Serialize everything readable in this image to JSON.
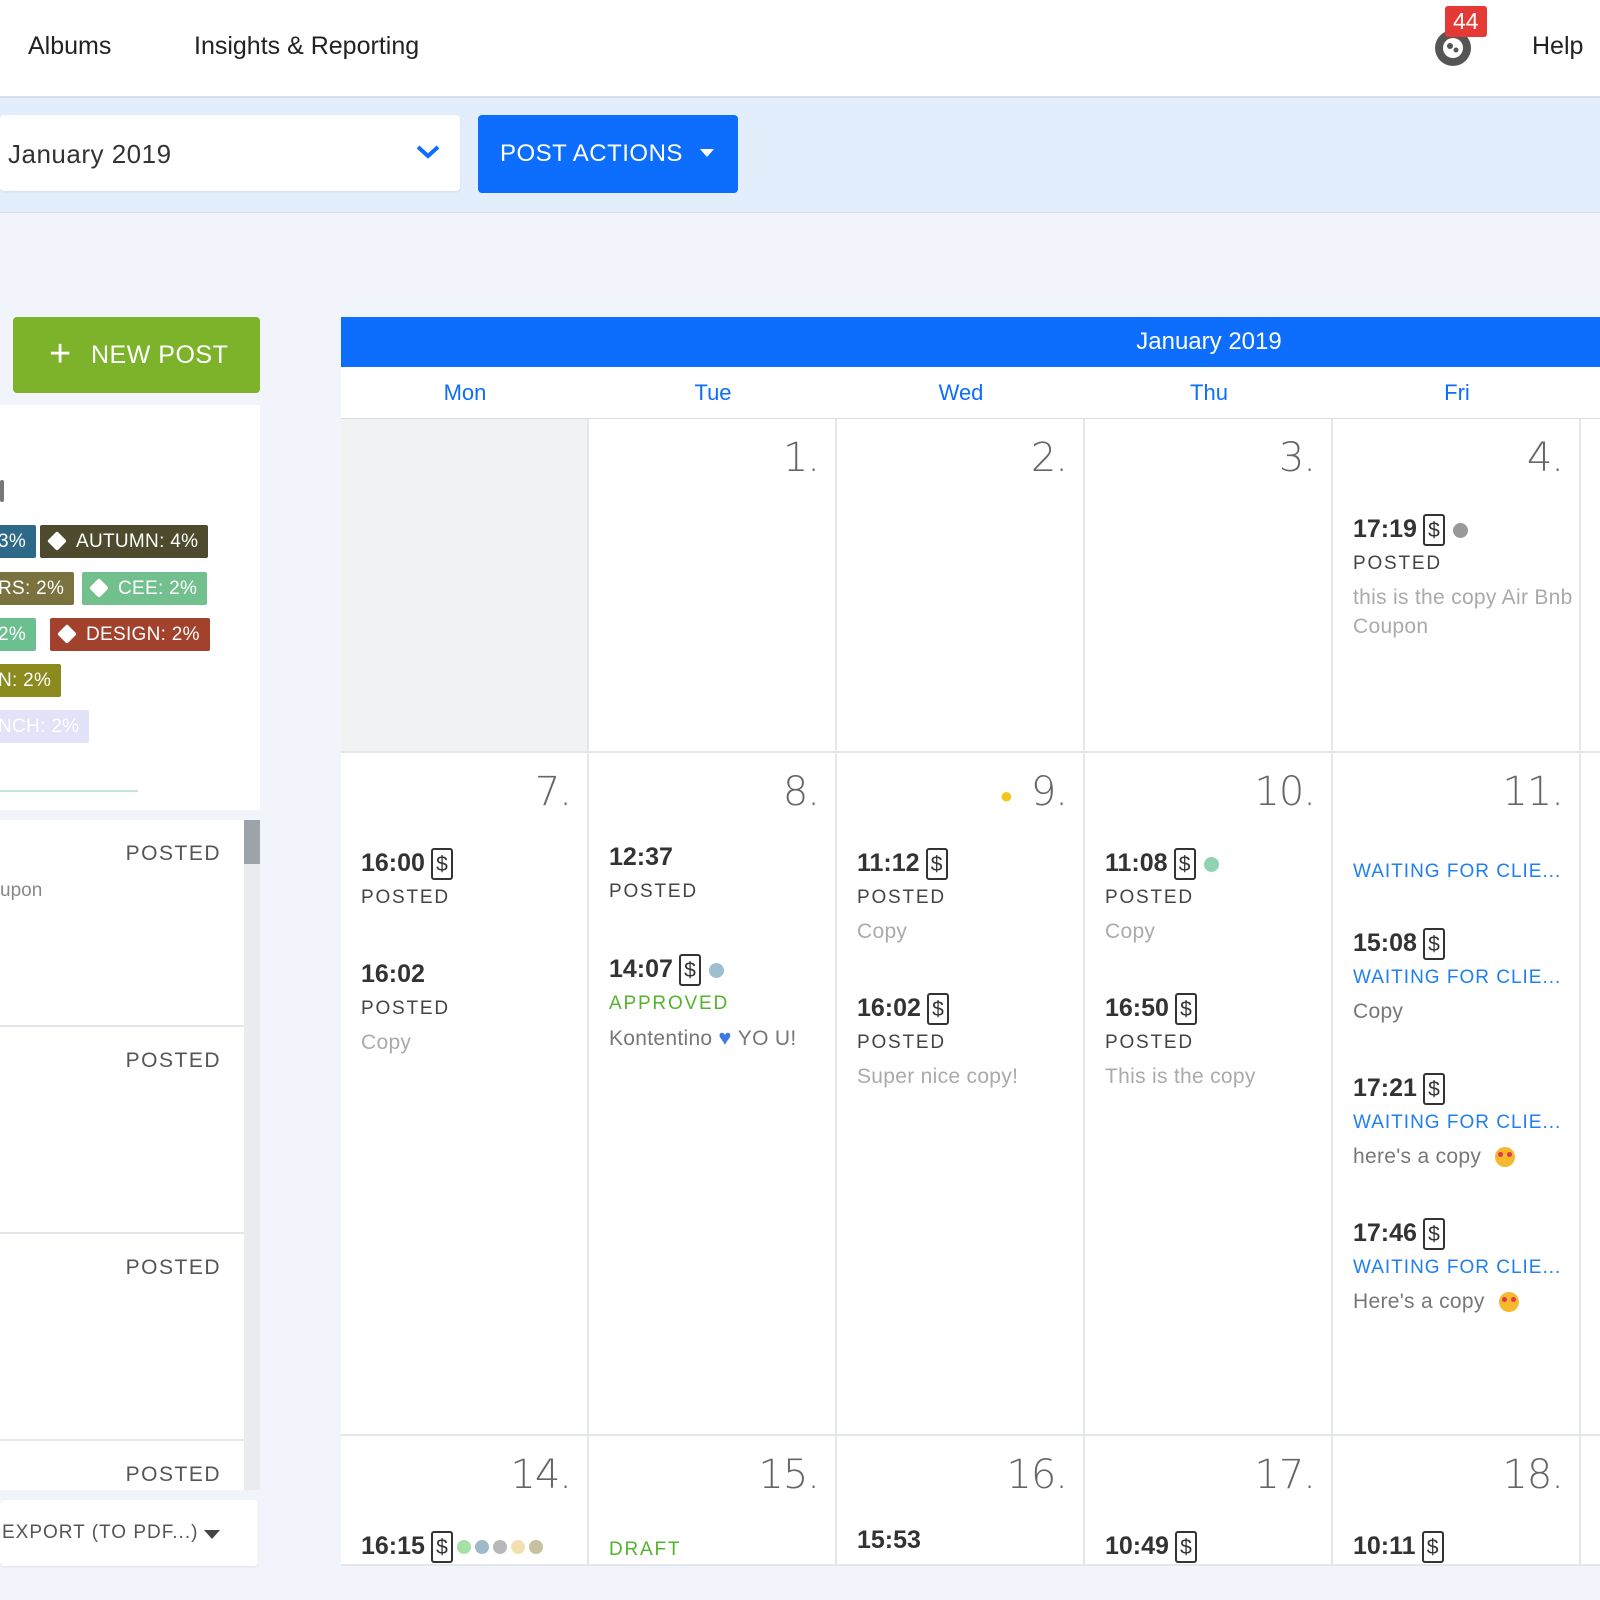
{
  "nav": {
    "albums": "Albums",
    "insights": "Insights & Reporting",
    "notification_count": "44",
    "help": "Help"
  },
  "toolbar": {
    "month_selected": "January 2019",
    "post_actions": "POST ACTIONS"
  },
  "sidebar": {
    "new_post": "NEW POST",
    "tags": [
      {
        "label": "3%",
        "color": "#2d6a8a"
      },
      {
        "label": "AUTUMN: 4%",
        "color": "#4d4a2e"
      },
      {
        "label": "RS: 2%",
        "color": "#7a7340"
      },
      {
        "label": "CEE: 2%",
        "color": "#73c08f"
      },
      {
        "label": "2%",
        "color": "#6cbf8e"
      },
      {
        "label": "DESIGN: 2%",
        "color": "#a2412c"
      },
      {
        "label": "N: 2%",
        "color": "#8a8a1e"
      },
      {
        "label": "NCH: 2%",
        "color": "#e2e2f8"
      }
    ],
    "list": [
      {
        "status": "POSTED",
        "snippet": "upon"
      },
      {
        "status": "POSTED",
        "snippet": ""
      },
      {
        "status": "POSTED",
        "snippet": ""
      },
      {
        "status": "POSTED",
        "snippet": ""
      }
    ],
    "export": "EXPORT (TO PDF...)"
  },
  "calendar": {
    "title": "January 2019",
    "days": [
      "Mon",
      "Tue",
      "Wed",
      "Thu",
      "Fri"
    ],
    "week1": {
      "d1": "1.",
      "d2": "2.",
      "d3": "3.",
      "d4": "4.",
      "fri_post": {
        "time": "17:19",
        "status": "POSTED",
        "copy": "this is the copy Air Bnb Coupon"
      }
    },
    "week2": {
      "mon": {
        "day": "7.",
        "posts": [
          {
            "time": "16:00",
            "status": "POSTED"
          },
          {
            "time": "16:02",
            "status": "POSTED",
            "copy": "Copy"
          }
        ]
      },
      "tue": {
        "day": "8.",
        "posts": [
          {
            "time": "12:37",
            "status": "POSTED"
          },
          {
            "time": "14:07",
            "status": "APPROVED",
            "copy_a": "Kontentino",
            "copy_b": "YO U!"
          }
        ]
      },
      "wed": {
        "day": "9.",
        "posts": [
          {
            "time": "11:12",
            "status": "POSTED",
            "copy": "Copy"
          },
          {
            "time": "16:02",
            "status": "POSTED",
            "copy": "Super nice copy!"
          }
        ]
      },
      "thu": {
        "day": "10.",
        "posts": [
          {
            "time": "11:08",
            "status": "POSTED",
            "copy": "Copy"
          },
          {
            "time": "16:50",
            "status": "POSTED",
            "copy": "This is the copy"
          }
        ]
      },
      "fri": {
        "day": "11.",
        "posts": [
          {
            "status": "WAITING FOR CLIE..."
          },
          {
            "time": "15:08",
            "status": "WAITING FOR CLIE...",
            "copy": "Copy"
          },
          {
            "time": "17:21",
            "status": "WAITING FOR CLIE...",
            "copy": "here's a copy"
          },
          {
            "time": "17:46",
            "status": "WAITING FOR CLIE...",
            "copy": "Here's a copy"
          }
        ]
      }
    },
    "week3": {
      "mon": {
        "day": "14.",
        "time": "16:15"
      },
      "tue": {
        "day": "15.",
        "status": "DRAFT"
      },
      "wed": {
        "day": "16.",
        "time": "15:53"
      },
      "thu": {
        "day": "17.",
        "time": "10:49"
      },
      "fri": {
        "day": "18.",
        "time": "10:11"
      }
    },
    "dollar_symbol": "$",
    "colors": {
      "header": "#0d6efd",
      "dot_gray": "#999999",
      "dot_teal": "#8fd3b3",
      "dot_blue": "#9fbfd0",
      "dot_green": "#a6e0a6",
      "dot_steel": "#a0b8c8",
      "dot_silver": "#b8b8b8",
      "dot_cream": "#f3e0b0",
      "dot_khaki": "#c9c0a0"
    }
  }
}
